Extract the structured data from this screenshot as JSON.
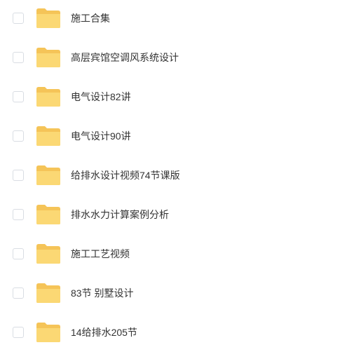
{
  "folders": [
    {
      "name": "施工合集"
    },
    {
      "name": "高层宾馆空调风系统设计"
    },
    {
      "name": "电气设计82讲"
    },
    {
      "name": "电气设计90讲"
    },
    {
      "name": "给排水设计视频74节课版"
    },
    {
      "name": "排水水力计算案例分析"
    },
    {
      "name": "施工工艺视频"
    },
    {
      "name": "83节 别墅设计"
    },
    {
      "name": "14给排水205节"
    }
  ],
  "colors": {
    "folder_back": "#f5c458",
    "folder_front": "#fbd874",
    "checkbox_border": "#d9dde3",
    "text": "#333333"
  },
  "icons": {
    "folder": "folder-icon",
    "checkbox": "checkbox-icon"
  }
}
